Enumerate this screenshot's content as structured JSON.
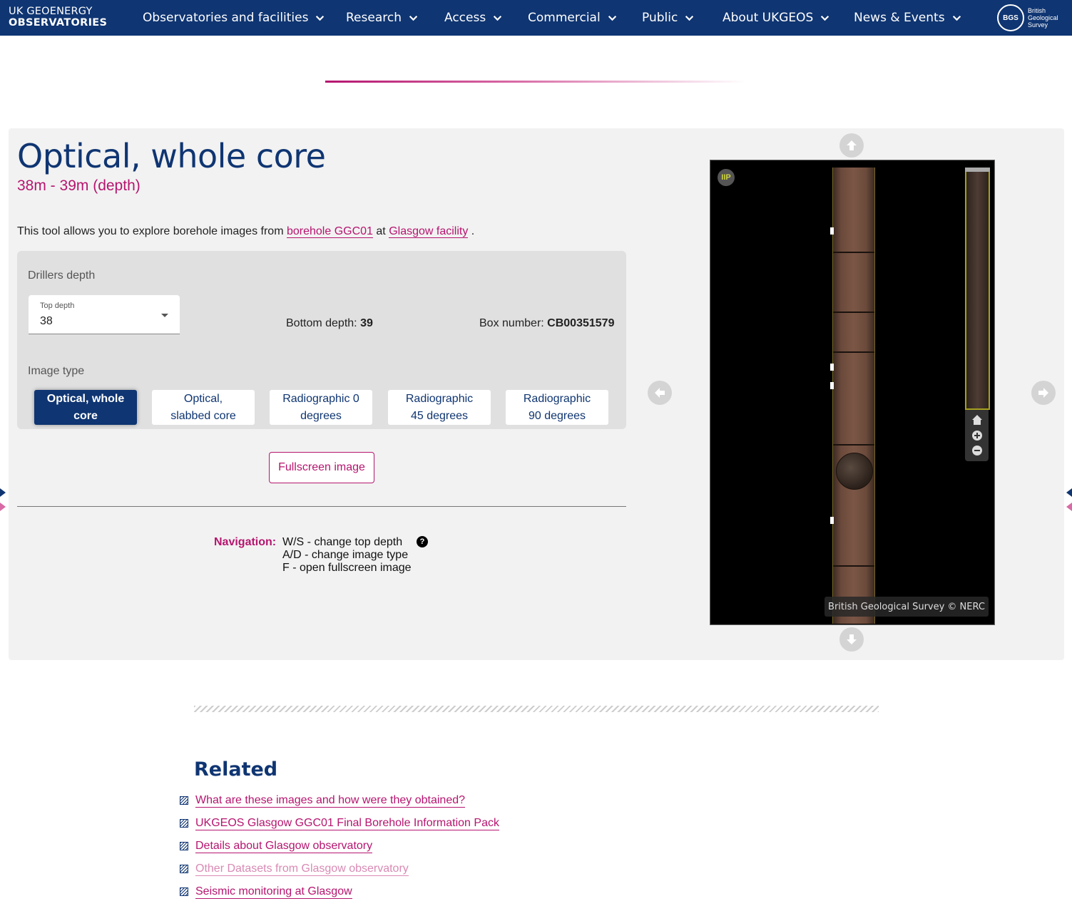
{
  "header": {
    "brand_line1": "UK GEOENERGY",
    "brand_line2": "OBSERVATORIES",
    "nav": [
      {
        "label": "Observatories and facilities"
      },
      {
        "label": "Research"
      },
      {
        "label": "Access"
      },
      {
        "label": "Commercial"
      },
      {
        "label": "Public"
      },
      {
        "label": "About UKGEOS"
      },
      {
        "label": "News & Events"
      }
    ],
    "bgs_logo": {
      "mark": "BGS",
      "lines": [
        "British",
        "Geological",
        "Survey"
      ]
    }
  },
  "main": {
    "title": "Optical, whole core",
    "subtitle": "38m - 39m (depth)",
    "intro": {
      "before": "This tool allows you to explore borehole images from",
      "link1": "borehole GGC01",
      "middle": "at",
      "link2": "Glasgow facility",
      "after": "."
    },
    "form": {
      "section_label": "Drillers depth",
      "top_depth_label": "Top depth",
      "top_depth_value": "38",
      "bottom_depth_label": "Bottom depth:",
      "bottom_depth_value": "39",
      "box_number_label": "Box number:",
      "box_number_value": "CB00351579",
      "image_type_label": "Image type",
      "image_types": [
        {
          "line1": "Optical, whole",
          "line2": "core",
          "active": true
        },
        {
          "line1": "Optical,",
          "line2": "slabbed core",
          "active": false
        },
        {
          "line1": "Radiographic 0",
          "line2": "degrees",
          "active": false
        },
        {
          "line1": "Radiographic",
          "line2": "45 degrees",
          "active": false
        },
        {
          "line1": "Radiographic",
          "line2": "90 degrees",
          "active": false
        }
      ]
    },
    "fullscreen_label": "Fullscreen image",
    "navigation": {
      "label": "Navigation:",
      "lines": [
        "W/S - change top depth",
        "A/D - change image type",
        "F - open fullscreen image"
      ],
      "help_glyph": "?"
    },
    "viewer": {
      "iip_label": "IIP",
      "credit": "British Geological Survey © NERC"
    }
  },
  "related": {
    "title": "Related",
    "links": [
      {
        "label": "What are these images and how were they obtained?",
        "muted": false
      },
      {
        "label": "UKGEOS Glasgow GGC01 Final Borehole Information Pack",
        "muted": false
      },
      {
        "label": "Details about Glasgow observatory",
        "muted": false
      },
      {
        "label": "Other Datasets from Glasgow observatory",
        "muted": true
      },
      {
        "label": "Seismic monitoring at Glasgow",
        "muted": false
      }
    ]
  },
  "colors": {
    "primary": "#0f3572",
    "accent": "#b5156f",
    "panel": "#f2f2f2"
  },
  "icons": [
    "chevron-down-icon",
    "arrow-up-icon",
    "arrow-down-icon",
    "arrow-left-icon",
    "arrow-right-icon",
    "home-icon",
    "zoom-in-icon",
    "zoom-out-icon",
    "help-icon",
    "list-bullet-icon"
  ]
}
